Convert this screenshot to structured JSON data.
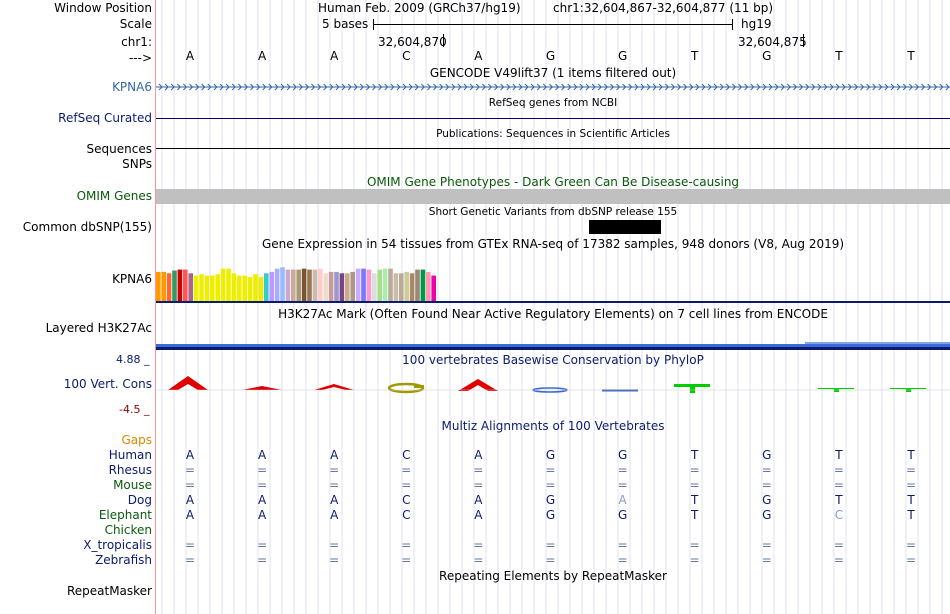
{
  "colors": {
    "link_blue": "#3366aa",
    "navy": "#0b1b6e",
    "green_label": "#0a5a0a",
    "gaps_orange": "#d88a00",
    "maroon": "#880000",
    "phylo_red": "#e00000",
    "phylo_olive": "#a09a00",
    "phylo_green": "#00cc00",
    "omim_bar": "#c0c0c0",
    "h3k27ac_blue": "#3b6bd6",
    "grid": "#e2e2ef",
    "left_border": "#ff9999",
    "track_line": "#000066"
  },
  "header": {
    "window_position_label": "Window Position",
    "scale_label": "Scale",
    "chr_label": "chr1:",
    "arrow_label": "--->",
    "assembly_text": "Human Feb. 2009 (GRCh37/hg19)",
    "region_text": "chr1:32,604,867-32,604,877 (11 bp)",
    "scale_text": "5 bases",
    "scale_db": "hg19",
    "coord_1": "32,604,870",
    "coord_2": "32,604,875"
  },
  "reference_bases": [
    "A",
    "A",
    "A",
    "C",
    "A",
    "G",
    "G",
    "T",
    "G",
    "T",
    "T"
  ],
  "tracks": {
    "gencode": {
      "title": "GENCODE V49lift37 (1 items filtered out)",
      "gene_label": "KPNA6"
    },
    "refseq": {
      "title": "RefSeq genes from NCBI",
      "label": "RefSeq Curated"
    },
    "publications": {
      "title": "Publications: Sequences in Scientific Articles",
      "label_1": "Sequences",
      "label_2": "SNPs"
    },
    "omim": {
      "title": "OMIM Gene Phenotypes - Dark Green Can Be Disease-causing",
      "label": "OMIM Genes"
    },
    "dbsnp": {
      "title": "Short Genetic Variants from dbSNP release 155",
      "label": "Common dbSNP(155)"
    },
    "gtex": {
      "title": "Gene Expression in 54 tissues from GTEx RNA-seq of 17382 samples, 948 donors (V8, Aug 2019)",
      "label": "KPNA6"
    },
    "h3k27ac": {
      "title": "H3K27Ac Mark (Often Found Near Active Regulatory Elements) on 7 cell lines from ENCODE",
      "label": "Layered H3K27Ac"
    },
    "phylop": {
      "title": "100 vertebrates Basewise Conservation by PhyloP",
      "label": "100 Vert. Cons",
      "max_label": "4.88 _",
      "min_label": "-4.5 _"
    },
    "multiz": {
      "title": "Multiz Alignments of 100 Vertebrates"
    },
    "repeatmasker": {
      "title": "Repeating Elements by RepeatMasker",
      "label": "RepeatMasker"
    }
  },
  "gtex_bars": [
    {
      "color": "#ff9900",
      "value": 0.63
    },
    {
      "color": "#ff9900",
      "value": 0.63
    },
    {
      "color": "#ff6633",
      "value": 0.6
    },
    {
      "color": "#339966",
      "value": 0.66
    },
    {
      "color": "#cc0000",
      "value": 0.68
    },
    {
      "color": "#ff5555",
      "value": 0.68
    },
    {
      "color": "#aa6688",
      "value": 0.6
    },
    {
      "color": "#eeee00",
      "value": 0.55
    },
    {
      "color": "#eeee00",
      "value": 0.58
    },
    {
      "color": "#eeee00",
      "value": 0.55
    },
    {
      "color": "#eeee00",
      "value": 0.55
    },
    {
      "color": "#eeee00",
      "value": 0.58
    },
    {
      "color": "#eeee00",
      "value": 0.7
    },
    {
      "color": "#eeee00",
      "value": 0.7
    },
    {
      "color": "#eeee00",
      "value": 0.6
    },
    {
      "color": "#eeee00",
      "value": 0.55
    },
    {
      "color": "#eeee00",
      "value": 0.55
    },
    {
      "color": "#eeee00",
      "value": 0.52
    },
    {
      "color": "#eeee00",
      "value": 0.58
    },
    {
      "color": "#eeee00",
      "value": 0.52
    },
    {
      "color": "#33cccc",
      "value": 0.6
    },
    {
      "color": "#bb99ff",
      "value": 0.63
    },
    {
      "color": "#aaaaff",
      "value": 0.7
    },
    {
      "color": "#99bbff",
      "value": 0.73
    },
    {
      "color": "#ccaacc",
      "value": 0.68
    },
    {
      "color": "#ccaa99",
      "value": 0.68
    },
    {
      "color": "#aa9977",
      "value": 0.68
    },
    {
      "color": "#775533",
      "value": 0.7
    },
    {
      "color": "#997755",
      "value": 0.68
    },
    {
      "color": "#ccbbaa",
      "value": 0.68
    },
    {
      "color": "#ffcccc",
      "value": 0.7
    },
    {
      "color": "#eeddcc",
      "value": 0.6
    },
    {
      "color": "#cc9999",
      "value": 0.63
    },
    {
      "color": "#9999cc",
      "value": 0.63
    },
    {
      "color": "#774488",
      "value": 0.6
    },
    {
      "color": "#ccaa88",
      "value": 0.6
    },
    {
      "color": "#aa9988",
      "value": 0.63
    },
    {
      "color": "#ccaaff",
      "value": 0.7
    },
    {
      "color": "#7777ff",
      "value": 0.7
    },
    {
      "color": "#ff99cc",
      "value": 0.68
    },
    {
      "color": "#dddddd",
      "value": 0.6
    },
    {
      "color": "#aadd88",
      "value": 0.68
    },
    {
      "color": "#aaeeaa",
      "value": 0.7
    },
    {
      "color": "#bbaa99",
      "value": 0.7
    },
    {
      "color": "#ccbbaa",
      "value": 0.6
    },
    {
      "color": "#bbaa99",
      "value": 0.6
    },
    {
      "color": "#cccc99",
      "value": 0.63
    },
    {
      "color": "#aa8866",
      "value": 0.6
    },
    {
      "color": "#998877",
      "value": 0.68
    },
    {
      "color": "#009944",
      "value": 0.68
    },
    {
      "color": "#ff99aa",
      "value": 0.63
    },
    {
      "color": "#ee00aa",
      "value": 0.55
    },
    {
      "color": "#ffffff",
      "value": 0.0
    },
    {
      "color": "#ffffff",
      "value": 0.0
    }
  ],
  "alignment": {
    "gaps_label": "Gaps",
    "species": [
      {
        "name": "Human",
        "color": "#0b1b6e",
        "bases": [
          "A",
          "A",
          "A",
          "C",
          "A",
          "G",
          "G",
          "T",
          "G",
          "T",
          "T"
        ]
      },
      {
        "name": "Rhesus",
        "color": "#0b1b6e",
        "bases": [
          "=",
          "=",
          "=",
          "=",
          "=",
          "=",
          "=",
          "=",
          "=",
          "=",
          "="
        ]
      },
      {
        "name": "Mouse",
        "color": "#0a5a0a",
        "bases": [
          "=",
          "=",
          "=",
          "=",
          "=",
          "=",
          "=",
          "=",
          "=",
          "=",
          "="
        ]
      },
      {
        "name": "Dog",
        "color": "#0b1b6e",
        "bases": [
          "A",
          "A",
          "A",
          "C",
          "A",
          "G",
          "A",
          "T",
          "G",
          "T",
          "T"
        ]
      },
      {
        "name": "Elephant",
        "color": "#0a5a0a",
        "bases": [
          "A",
          "A",
          "A",
          "C",
          "A",
          "G",
          "G",
          "T",
          "G",
          "C",
          "T"
        ]
      },
      {
        "name": "Chicken",
        "color": "#0a5a0a",
        "bases": [
          "",
          "",
          "",
          "",
          "",
          "",
          "",
          "",
          "",
          "",
          ""
        ]
      },
      {
        "name": "X_tropicalis",
        "color": "#0b1b6e",
        "bases": [
          "=",
          "=",
          "=",
          "=",
          "=",
          "=",
          "=",
          "=",
          "=",
          "=",
          "="
        ]
      },
      {
        "name": "Zebrafish",
        "color": "#0b1b6e",
        "bases": [
          "=",
          "=",
          "=",
          "=",
          "=",
          "=",
          "=",
          "=",
          "=",
          "=",
          "="
        ]
      }
    ]
  }
}
